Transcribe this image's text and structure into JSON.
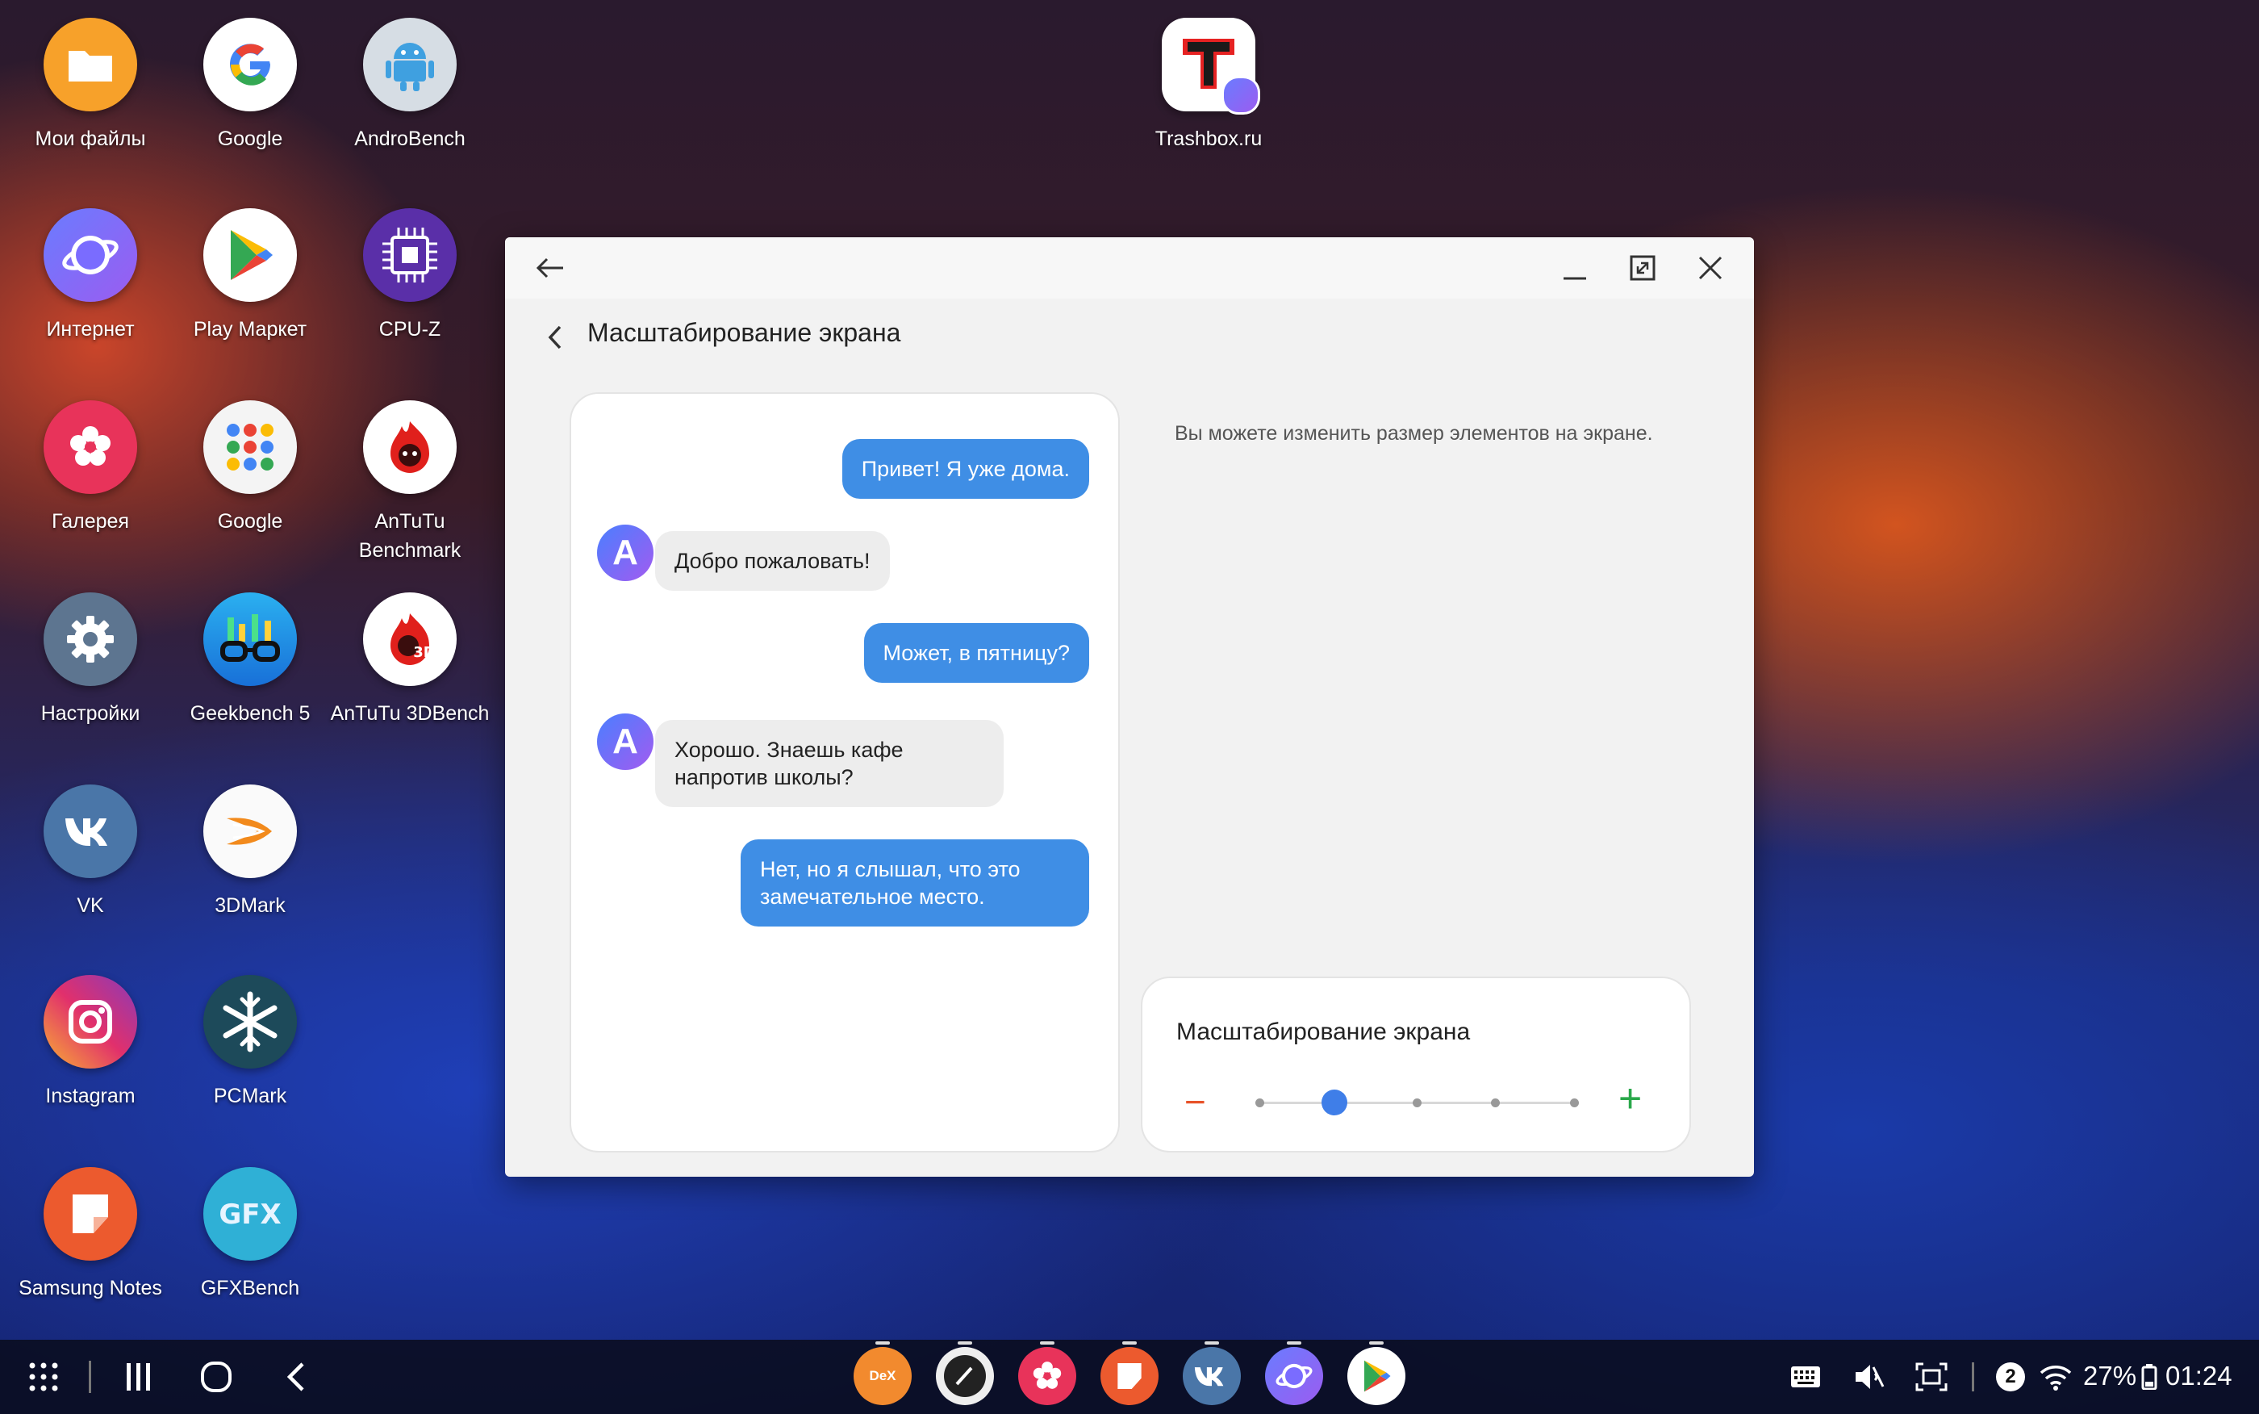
{
  "desktop": {
    "icons": [
      {
        "label": "Мои файлы"
      },
      {
        "label": "Google"
      },
      {
        "label": "AndroBench"
      },
      {
        "label": "Trashbox.ru"
      },
      {
        "label": "Интернет"
      },
      {
        "label": "Play Маркет"
      },
      {
        "label": "CPU-Z"
      },
      {
        "label": "Галерея"
      },
      {
        "label": "Google"
      },
      {
        "label": "AnTuTu Benchmark"
      },
      {
        "label": "Настройки"
      },
      {
        "label": "Geekbench 5"
      },
      {
        "label": "AnTuTu 3DBench"
      },
      {
        "label": "VK"
      },
      {
        "label": "3DMark"
      },
      {
        "label": "Instagram"
      },
      {
        "label": "PCMark"
      },
      {
        "label": "Samsung Notes"
      },
      {
        "label": "GFXBench"
      }
    ]
  },
  "window": {
    "page_title": "Масштабирование экрана",
    "chat": [
      {
        "side": "out",
        "text": "Привет! Я уже дома."
      },
      {
        "side": "in",
        "avatar": "A",
        "text": "Добро пожаловать!"
      },
      {
        "side": "out",
        "text": "Может, в пятницу?"
      },
      {
        "side": "in",
        "avatar": "A",
        "text": "Хорошо. Знаешь кафе напротив школы?"
      },
      {
        "side": "out",
        "text": "Нет, но я слышал, что это замечательное место."
      }
    ],
    "description": "Вы можете изменить размер элементов на экране.",
    "scale": {
      "title": "Масштабирование экрана",
      "minus": "−",
      "plus": "+",
      "steps": 5,
      "selected_step": 2
    }
  },
  "taskbar": {
    "dex_label": "DeX",
    "notification_count": "2",
    "battery": "27%",
    "time": "01:24"
  },
  "colors": {
    "accent_blue": "#3f8ee5",
    "slider_blue": "#3f7ee8",
    "minus_red": "#e8532a",
    "plus_green": "#2aa84a"
  }
}
